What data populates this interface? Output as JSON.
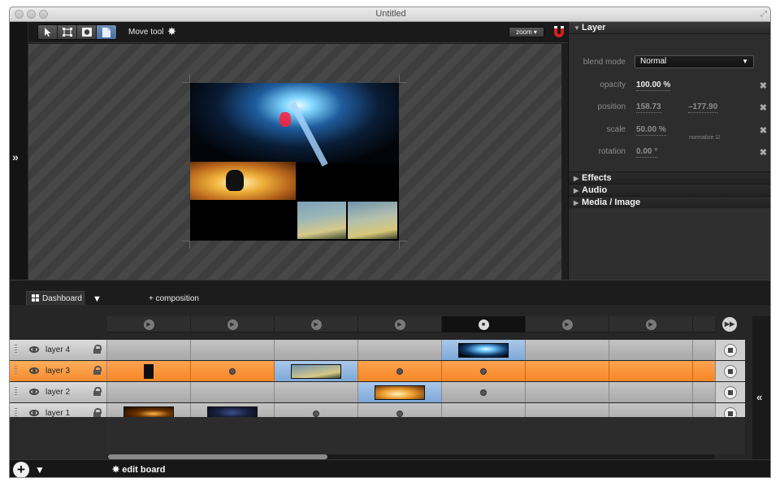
{
  "window": {
    "title": "Untitled"
  },
  "toolbar": {
    "tools": [
      "select-arrow",
      "transform-rect",
      "mask-circle",
      "file-doc"
    ],
    "tool_label": "Move tool",
    "zoom_label": "zoom ▾"
  },
  "layer_panel": {
    "title": "Layer",
    "blend_mode_label": "blend mode",
    "blend_mode_value": "Normal",
    "opacity_label": "opacity",
    "opacity_value": "100.00",
    "opacity_unit": "%",
    "position_label": "position",
    "position_x": "158.73",
    "position_y": "–177.90",
    "scale_label": "scale",
    "scale_value": "50.00",
    "scale_unit": "%",
    "normalize_label": "normalize",
    "rotation_label": "rotation",
    "rotation_value": "0.00",
    "rotation_unit": "°",
    "sections": [
      "Effects",
      "Audio",
      "Media / Image"
    ]
  },
  "dashboard": {
    "tab_label": "Dashboard",
    "add_composition_label": "+ composition"
  },
  "timeline": {
    "layers": [
      {
        "name": "layer 4"
      },
      {
        "name": "layer 3",
        "selected": true
      },
      {
        "name": "layer 2"
      },
      {
        "name": "layer 1"
      }
    ]
  },
  "bottom": {
    "edit_board_label": "edit board"
  },
  "colors": {
    "selection_orange": "#f48b2d",
    "active_cell_blue": "#7da8d8",
    "magnet_red": "#d42020"
  }
}
